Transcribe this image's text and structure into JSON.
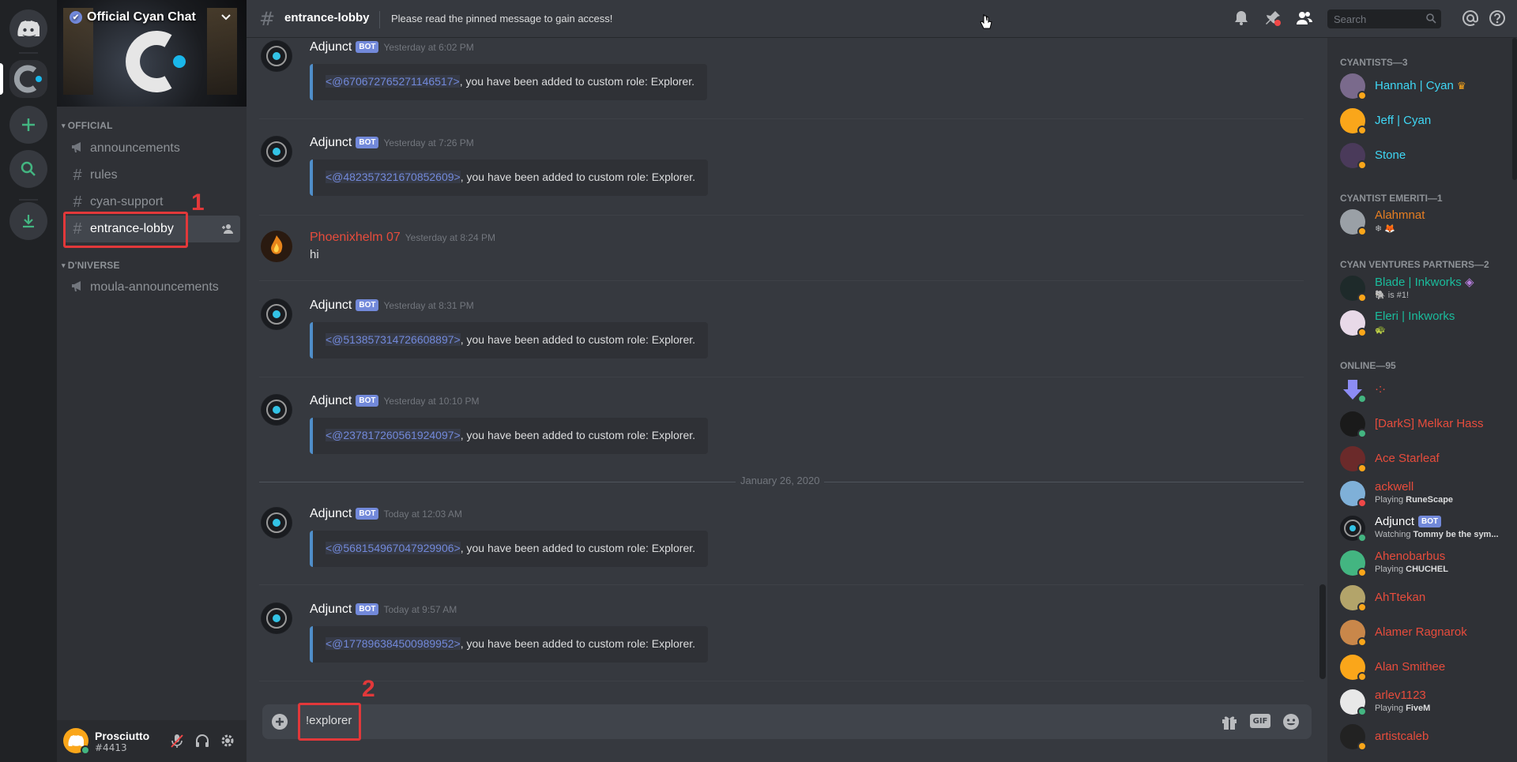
{
  "rail": {
    "home": "Home",
    "server": "Official Cyan Chat",
    "add": "Add a Server",
    "explore": "Explore Public Servers",
    "download": "Download Apps"
  },
  "sidebar": {
    "server_name": "Official Cyan Chat",
    "categories": [
      {
        "label": "OFFICIAL",
        "channels": [
          "announcements",
          "rules",
          "cyan-support",
          "entrance-lobby"
        ]
      },
      {
        "label": "D'NIVERSE",
        "channels": [
          "moula-announcements"
        ]
      }
    ],
    "annotation_1": "1"
  },
  "user": {
    "name": "Prosciutto",
    "tag": "#4413"
  },
  "header": {
    "channel": "entrance-lobby",
    "topic": "Please read the pinned message to gain access!",
    "search_placeholder": "Search"
  },
  "messages": [
    {
      "author": "Adjunct",
      "bot": "BOT",
      "time": "Yesterday at 6:02 PM",
      "mention": "<@670672765271146517>",
      "text": ", you have been added to custom role: Explorer."
    },
    {
      "author": "Adjunct",
      "bot": "BOT",
      "time": "Yesterday at 7:26 PM",
      "mention": "<@482357321670852609>",
      "text": ", you have been added to custom role: Explorer."
    },
    {
      "author": "Phoenixhelm 07",
      "time": "Yesterday at 8:24 PM",
      "body": "hi"
    },
    {
      "author": "Adjunct",
      "bot": "BOT",
      "time": "Yesterday at 8:31 PM",
      "mention": "<@513857314726608897>",
      "text": ", you have been added to custom role: Explorer."
    },
    {
      "author": "Adjunct",
      "bot": "BOT",
      "time": "Yesterday at 10:10 PM",
      "mention": "<@237817260561924097>",
      "text": ", you have been added to custom role: Explorer."
    },
    {
      "author": "Adjunct",
      "bot": "BOT",
      "time": "Today at 12:03 AM",
      "mention": "<@568154967047929906>",
      "text": ", you have been added to custom role: Explorer."
    },
    {
      "author": "Adjunct",
      "bot": "BOT",
      "time": "Today at 9:57 AM",
      "mention": "<@177896384500989952>",
      "text": ", you have been added to custom role: Explorer."
    }
  ],
  "day_divider": "January 26, 2020",
  "composer": {
    "value": "!explorer",
    "annotation_2": "2",
    "gif": "GIF"
  },
  "members": {
    "groups": [
      "CYANTISTS—3",
      "CYANTIST EMERITI—1",
      "CYAN VENTURES PARTNERS—2",
      "ONLINE—95"
    ],
    "list": [
      {
        "name": "Hannah | Cyan",
        "color": "#3fd7f5",
        "crown": "♛"
      },
      {
        "name": "Jeff | Cyan",
        "color": "#3fd7f5"
      },
      {
        "name": "Stone",
        "color": "#3fd7f5"
      },
      {
        "name": "Alahmnat",
        "color": "#e67e22",
        "sub": "❄ 🦊"
      },
      {
        "name": "Blade | Inkworks",
        "color": "#1abc9c",
        "sub": "🐘 is #1!"
      },
      {
        "name": "Eleri | Inkworks",
        "color": "#1abc9c",
        "sub": "🐢"
      },
      {
        "name": "·:·",
        "color": "#e74c3c"
      },
      {
        "name": "[DarkS] Melkar Hass",
        "color": "#e74c3c"
      },
      {
        "name": "Ace Starleaf",
        "color": "#e74c3c"
      },
      {
        "name": "ackwell",
        "color": "#e74c3c",
        "sub_prefix": "Playing ",
        "sub_bold": "RuneScape"
      },
      {
        "name": "Adjunct",
        "color": "#ffffff",
        "bot": "BOT",
        "sub_prefix": "Watching ",
        "sub_bold": "Tommy be the sym..."
      },
      {
        "name": "Ahenobarbus",
        "color": "#e74c3c",
        "sub_prefix": "Playing ",
        "sub_bold": "CHUCHEL"
      },
      {
        "name": "AhTtekan",
        "color": "#e74c3c"
      },
      {
        "name": "Alamer Ragnarok",
        "color": "#e74c3c"
      },
      {
        "name": "Alan Smithee",
        "color": "#e74c3c"
      },
      {
        "name": "arlev1123",
        "color": "#e74c3c",
        "sub_prefix": "Playing ",
        "sub_bold": "FiveM"
      },
      {
        "name": "artistcaleb",
        "color": "#e74c3c"
      }
    ]
  },
  "colors": {
    "accent": "#7289da",
    "online": "#43b581",
    "idle": "#faa61a",
    "dnd": "#f04747",
    "highlight": "#e2383a"
  }
}
